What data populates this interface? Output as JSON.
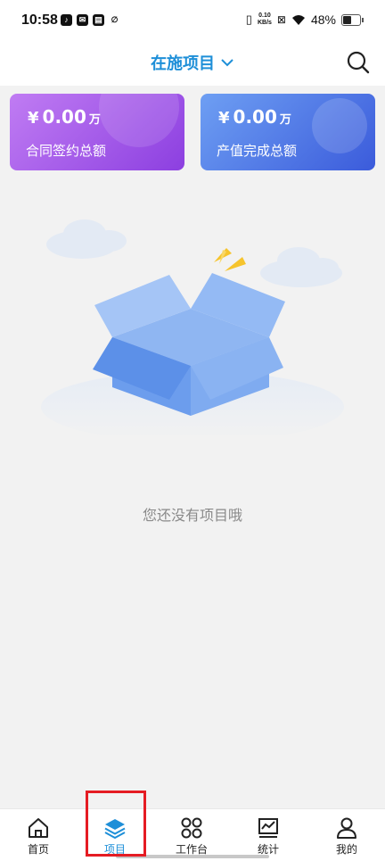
{
  "status_bar": {
    "time": "10:58",
    "net_speed_value": "0.10",
    "net_speed_unit": "KB/s",
    "battery": "48%"
  },
  "nav": {
    "title": "在施项目"
  },
  "cards": [
    {
      "currency": "¥",
      "value": "0.00",
      "unit": "万",
      "label": "合同签约总额"
    },
    {
      "currency": "¥",
      "value": "0.00",
      "unit": "万",
      "label": "产值完成总额"
    }
  ],
  "empty_state": {
    "message": "您还没有项目哦"
  },
  "tabs": [
    {
      "label": "首页",
      "icon": "home-icon"
    },
    {
      "label": "项目",
      "icon": "layers-icon"
    },
    {
      "label": "工作台",
      "icon": "grid-icon"
    },
    {
      "label": "统计",
      "icon": "chart-icon"
    },
    {
      "label": "我的",
      "icon": "user-icon"
    }
  ],
  "active_tab_index": 1,
  "colors": {
    "accent": "#1e8fd8",
    "highlight": "#e51c23",
    "card_purple": "#a259ea",
    "card_blue": "#4f74e3"
  }
}
